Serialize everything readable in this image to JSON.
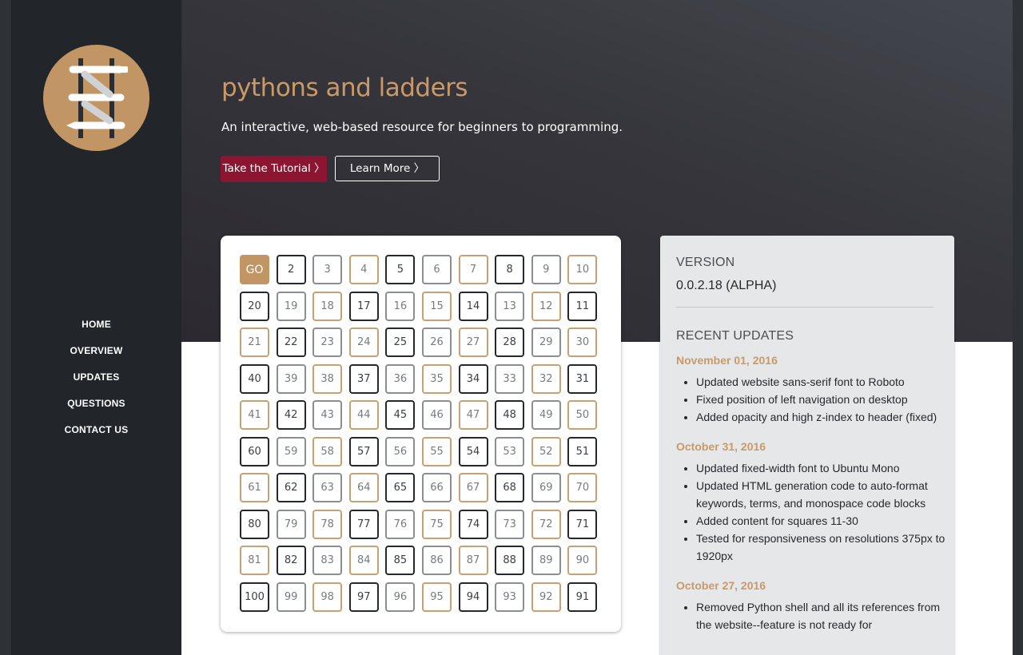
{
  "nav": {
    "items": [
      {
        "label": "HOME"
      },
      {
        "label": "OVERVIEW"
      },
      {
        "label": "UPDATES"
      },
      {
        "label": "QUESTIONS"
      },
      {
        "label": "CONTACT US"
      }
    ]
  },
  "hero": {
    "title": "pythons and ladders",
    "subtitle": "An interactive, web-based resource for beginners to programming.",
    "primary_button": "Take the Tutorial 〉",
    "secondary_button": "Learn More 〉"
  },
  "board": {
    "rows": [
      [
        "GO",
        "2",
        "3",
        "4",
        "5",
        "6",
        "7",
        "8",
        "9",
        "10"
      ],
      [
        "20",
        "19",
        "18",
        "17",
        "16",
        "15",
        "14",
        "13",
        "12",
        "11"
      ],
      [
        "21",
        "22",
        "23",
        "24",
        "25",
        "26",
        "27",
        "28",
        "29",
        "30"
      ],
      [
        "40",
        "39",
        "38",
        "37",
        "36",
        "35",
        "34",
        "33",
        "32",
        "31"
      ],
      [
        "41",
        "42",
        "43",
        "44",
        "45",
        "46",
        "47",
        "48",
        "49",
        "50"
      ],
      [
        "60",
        "59",
        "58",
        "57",
        "56",
        "55",
        "54",
        "53",
        "52",
        "51"
      ],
      [
        "61",
        "62",
        "63",
        "64",
        "65",
        "66",
        "67",
        "68",
        "69",
        "70"
      ],
      [
        "80",
        "79",
        "78",
        "77",
        "76",
        "75",
        "74",
        "73",
        "72",
        "71"
      ],
      [
        "81",
        "82",
        "83",
        "84",
        "85",
        "86",
        "87",
        "88",
        "89",
        "90"
      ],
      [
        "100",
        "99",
        "98",
        "97",
        "96",
        "95",
        "94",
        "93",
        "92",
        "91"
      ]
    ],
    "pattern_rows": {
      "A": [
        "go",
        "dark",
        "gray",
        "gold",
        "dark",
        "gray",
        "gold",
        "dark",
        "gray",
        "gold"
      ],
      "B": [
        "dark",
        "gray",
        "gold",
        "dark",
        "gray",
        "gold",
        "dark",
        "gray",
        "gold",
        "dark"
      ],
      "C": [
        "gold",
        "dark",
        "gray",
        "gold",
        "dark",
        "gray",
        "gold",
        "dark",
        "gray",
        "gold"
      ]
    },
    "row_patterns": [
      "A",
      "B",
      "C",
      "B",
      "C",
      "B",
      "C",
      "B",
      "C",
      "B"
    ],
    "colors": {
      "go": "#c19664",
      "gold": "#c9a071",
      "dark": "#25292e",
      "gray": "#8a8e93"
    }
  },
  "info": {
    "version_heading": "VERSION",
    "version_value": "0.0.2.18 (ALPHA)",
    "updates_heading": "RECENT UPDATES",
    "updates": [
      {
        "date": "November 01, 2016",
        "items": [
          "Updated website sans-serif font to Roboto",
          "Fixed position of left navigation on desktop",
          "Added opacity and high z-index to header (fixed)"
        ]
      },
      {
        "date": "October 31, 2016",
        "items": [
          "Updated fixed-width font to Ubuntu Mono",
          "Updated HTML generation code to auto-format keywords, terms, and monospace code blocks",
          "Added content for squares 11-30",
          "Tested for responsiveness on resolutions 375px to 1920px"
        ]
      },
      {
        "date": "October 27, 2016",
        "items": [
          "Removed Python shell and all its references from the website--feature is not ready for"
        ]
      }
    ]
  },
  "colors": {
    "sidebar": "#22262b",
    "accent_gold": "#c99a68",
    "primary_button": "#8c1532",
    "info_card": "#e6e7e9"
  },
  "icons": {
    "logo": "ladder-and-python-logo"
  }
}
